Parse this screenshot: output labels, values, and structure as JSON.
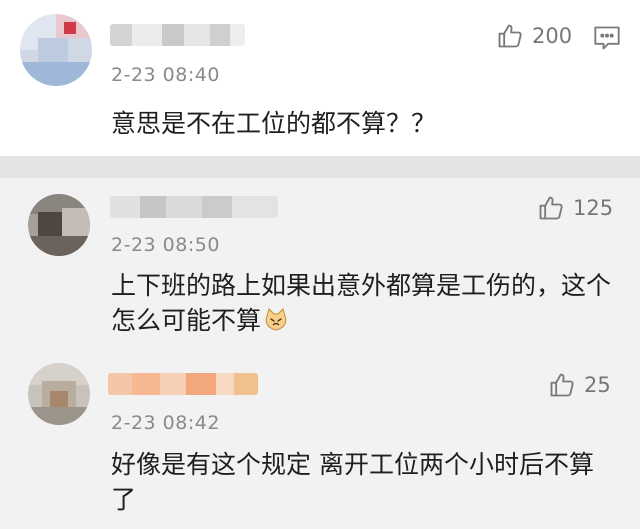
{
  "comments": [
    {
      "time": "2-23 08:40",
      "likes": "200",
      "text": "意思是不在工位的都不算？？"
    },
    {
      "time": "2-23 08:50",
      "likes": "125",
      "text_line1": "上下班的路上如果出意外都算是工伤的，这个",
      "text_line2": "怎么可能不算"
    },
    {
      "time": "2-23 08:42",
      "likes": "25",
      "text_line1": "好像是有这个规定 离开工位两个小时后不算",
      "text_line2": "了"
    }
  ],
  "icons": {
    "like": "thumbs-up-icon",
    "reply": "comment-icon",
    "emoji": "cat-emoji-icon"
  }
}
